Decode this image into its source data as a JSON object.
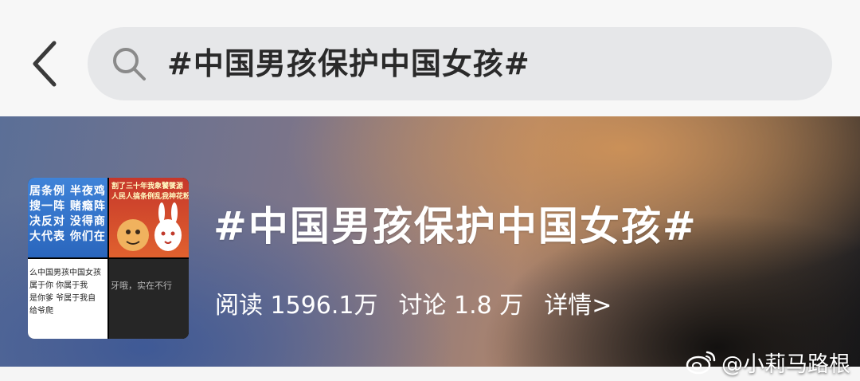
{
  "search": {
    "query": "#中国男孩保护中国女孩#"
  },
  "topic": {
    "title": "#中国男孩保护中国女孩#",
    "reads": "阅读 1596.1万",
    "discussions": "讨论 1.8 万",
    "details_link": "详情>"
  },
  "thumbnail": {
    "q1_text": "居条例 半夜鸡\n搜一阵 赌瘾阵\n决反对 没得商\n大代表 你们在",
    "q2_text": "割了三十年我象饕餮源\n人民人搞条例乱我神花粉",
    "q3_text": "么中国男孩中国女孩\n属于你 你属于我\n是你爹 爷属于我自\n给爷爬",
    "q4_text": "牙哦，实在不行"
  },
  "watermark": {
    "text": "@小莉马路根"
  },
  "colors": {
    "search_bg": "#e6e7e9",
    "topbar_bg": "#f7f7f7",
    "text_dark": "#2a2a2a"
  },
  "icons": {
    "back": "chevron-left-icon",
    "search": "search-icon",
    "watermark": "weibo-logo-icon"
  }
}
